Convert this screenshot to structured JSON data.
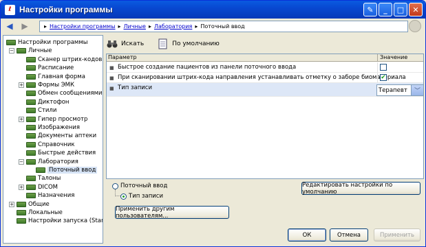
{
  "window": {
    "title": "Настройки программы"
  },
  "nav": {
    "crumbs": [
      "Настройки программы",
      "Личные",
      "Лаборатория"
    ],
    "current": "Поточный ввод"
  },
  "tree": {
    "items": [
      {
        "label": "Настройки программы",
        "level": 0,
        "expander": ""
      },
      {
        "label": "Личные",
        "level": 1,
        "expander": "−"
      },
      {
        "label": "Сканер штрих-кодов",
        "level": 2,
        "expander": ""
      },
      {
        "label": "Расписание",
        "level": 2,
        "expander": ""
      },
      {
        "label": "Главная форма",
        "level": 2,
        "expander": ""
      },
      {
        "label": "Формы ЭМК",
        "level": 2,
        "expander": "+"
      },
      {
        "label": "Обмен сообщениями",
        "level": 2,
        "expander": ""
      },
      {
        "label": "Диктофон",
        "level": 2,
        "expander": ""
      },
      {
        "label": "Стили",
        "level": 2,
        "expander": ""
      },
      {
        "label": "Гипер просмотр",
        "level": 2,
        "expander": "+"
      },
      {
        "label": "Изображения",
        "level": 2,
        "expander": ""
      },
      {
        "label": "Документы аптеки",
        "level": 2,
        "expander": ""
      },
      {
        "label": "Справочник",
        "level": 2,
        "expander": ""
      },
      {
        "label": "Быстрые действия",
        "level": 2,
        "expander": ""
      },
      {
        "label": "Лаборатория",
        "level": 2,
        "expander": "−"
      },
      {
        "label": "Поточный ввод",
        "level": 3,
        "expander": "",
        "selected": true
      },
      {
        "label": "Талоны",
        "level": 2,
        "expander": ""
      },
      {
        "label": "DICOM",
        "level": 2,
        "expander": "+"
      },
      {
        "label": "Назначения",
        "level": 2,
        "expander": ""
      },
      {
        "label": "Общие",
        "level": 1,
        "expander": "+"
      },
      {
        "label": "Локальные",
        "level": 1,
        "expander": ""
      },
      {
        "label": "Настройки запуска (StartUp)",
        "level": 1,
        "expander": ""
      }
    ]
  },
  "toolbar": {
    "search_label": "Искать",
    "default_label": "По умолчанию"
  },
  "grid": {
    "col_param": "Параметр",
    "col_value": "Значение",
    "rows": [
      {
        "label": "Быстрое создание пациентов из панели поточного ввода",
        "checked": false
      },
      {
        "label": "При сканировании штрих-кода направления устанавливать отметку о заборе биоматериала",
        "checked": true
      },
      {
        "label": "Тип записи",
        "value": "Терапевт"
      }
    ]
  },
  "radios": {
    "first": "Поточный ввод",
    "second": "Тип записи"
  },
  "buttons": {
    "edit_defaults": "Редактировать настройки по умолчанию",
    "apply_others": "Применить другим пользователям...",
    "ok": "ОК",
    "cancel": "Отмена",
    "apply": "Применить"
  },
  "colors": {
    "accent": "#0a5be0",
    "check": "#21a121",
    "folder": "#4e8a34"
  }
}
